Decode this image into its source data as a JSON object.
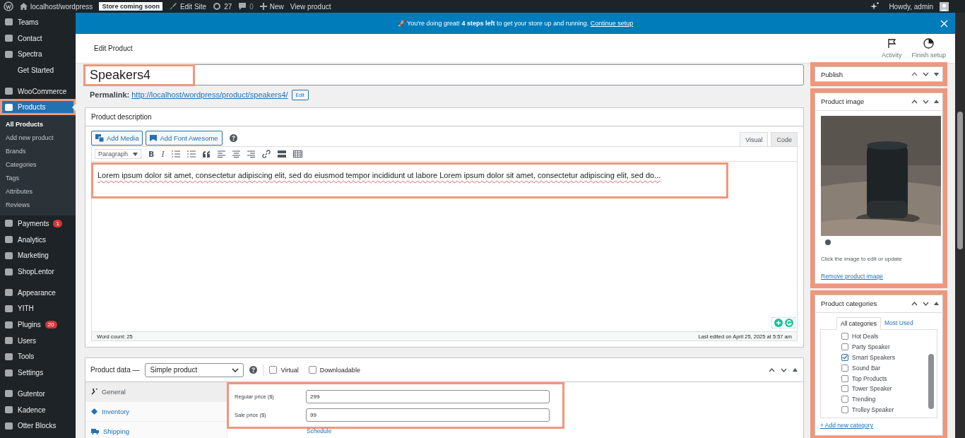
{
  "admin_bar": {
    "site": "localhost/wordpress",
    "badge": "Store coming soon",
    "items": [
      {
        "kind": "edit",
        "label": "Edit Site"
      },
      {
        "kind": "updates",
        "label": "27"
      },
      {
        "kind": "comments",
        "label": "0"
      },
      {
        "kind": "new",
        "label": "New"
      },
      {
        "kind": "link",
        "label": "View product"
      }
    ],
    "greeting": "Howdy, admin"
  },
  "sidebar": {
    "groups": [
      {
        "items": [
          {
            "kind": "icon",
            "label": "Teams",
            "selected": false,
            "highlighted": false
          },
          {
            "kind": "icon",
            "label": "Contact",
            "selected": false,
            "highlighted": false
          },
          {
            "kind": "icon",
            "label": "Spectra",
            "selected": false,
            "highlighted": false
          },
          {
            "kind": "plain",
            "label": "Get Started",
            "selected": false,
            "highlighted": false
          }
        ]
      },
      {
        "items": [
          {
            "kind": "icon",
            "label": "WooCommerce",
            "selected": false,
            "highlighted": false
          },
          {
            "kind": "icon",
            "label": "Products",
            "selected": true,
            "highlighted": true,
            "children": [
              {
                "label": "All Products",
                "selected": true
              },
              {
                "label": "Add new product",
                "selected": false
              },
              {
                "label": "Brands",
                "selected": false
              },
              {
                "label": "Categories",
                "selected": false
              },
              {
                "label": "Tags",
                "selected": false
              },
              {
                "label": "Attributes",
                "selected": false
              },
              {
                "label": "Reviews",
                "selected": false
              }
            ]
          },
          {
            "kind": "icon",
            "label": "Payments",
            "badge": "1",
            "selected": false,
            "highlighted": false
          },
          {
            "kind": "icon",
            "label": "Analytics",
            "selected": false,
            "highlighted": false
          },
          {
            "kind": "icon",
            "label": "Marketing",
            "selected": false,
            "highlighted": false
          },
          {
            "kind": "icon",
            "label": "ShopLentor",
            "selected": false,
            "highlighted": false
          }
        ]
      },
      {
        "items": [
          {
            "kind": "icon",
            "label": "Appearance",
            "selected": false,
            "highlighted": false
          },
          {
            "kind": "icon",
            "label": "YITH",
            "selected": false,
            "highlighted": false
          },
          {
            "kind": "icon",
            "label": "Plugins",
            "badge": "20",
            "selected": false,
            "highlighted": false
          },
          {
            "kind": "icon",
            "label": "Users",
            "selected": false,
            "highlighted": false
          },
          {
            "kind": "icon",
            "label": "Tools",
            "selected": false,
            "highlighted": false
          },
          {
            "kind": "icon",
            "label": "Settings",
            "selected": false,
            "highlighted": false
          }
        ]
      },
      {
        "items": [
          {
            "kind": "icon",
            "label": "Gutentor",
            "selected": false,
            "highlighted": false
          },
          {
            "kind": "icon",
            "label": "Kadence",
            "selected": false,
            "highlighted": false
          },
          {
            "kind": "icon",
            "label": "Otter Blocks",
            "selected": false,
            "highlighted": false
          }
        ]
      }
    ]
  },
  "notice": {
    "text": "🚀 You're doing great! **4 steps left** to get your store up and running.",
    "link": "Continue setup"
  },
  "header": {
    "title": "Edit Product",
    "actions": [
      {
        "kind": "flag",
        "label": "Activity"
      },
      {
        "kind": "clock",
        "label": "Finish setup"
      }
    ]
  },
  "title_field": {
    "value": "Speakers4",
    "highlighted": true
  },
  "permalink": {
    "label": "Permalink:",
    "url": "http://localhost/wordpress/product/speakers4/",
    "button": "Edit"
  },
  "description": {
    "title": "Product description",
    "buttons": [
      "Add Media",
      "Add Font Awesome"
    ],
    "tabs": [
      {
        "label": "Visual",
        "selected": true
      },
      {
        "label": "Code",
        "selected": false
      }
    ],
    "format": "Paragraph",
    "toolbar": [
      "B",
      "I"
    ],
    "content": "Lorem ipsum dolor sit amet, consectetur adipiscing elit, sed do eiusmod tempor incididunt ut labore Lorem ipsum dolor sit amet, consectetur adipiscing elit, sed do...",
    "highlighted": true,
    "word_count": "Word count: 25",
    "last_edited": "Last edited on April 25, 2025 at 5:57 am"
  },
  "product_data": {
    "label": "Product data —",
    "type": "Simple product",
    "options": [
      {
        "label": "Virtual",
        "checked": false
      },
      {
        "label": "Downloadable",
        "checked": false
      }
    ],
    "tabs": [
      {
        "label": "General",
        "selected": true
      },
      {
        "label": "Inventory",
        "selected": false
      },
      {
        "label": "Shipping",
        "selected": false
      }
    ],
    "fields": [
      {
        "label": "Regular price ($)",
        "value": "299"
      },
      {
        "label": "Sale price ($)",
        "value": "99"
      }
    ],
    "schedule": "Schedule",
    "highlighted": true
  },
  "publish": {
    "title": "Publish",
    "highlighted": true
  },
  "product_image": {
    "title": "Product image",
    "hint": "Click the image to edit or update",
    "remove": "Remove product image",
    "highlighted": true
  },
  "categories": {
    "title": "Product categories",
    "highlighted": true,
    "tabs": [
      {
        "label": "All categories",
        "selected": true
      },
      {
        "label": "Most Used",
        "selected": false
      }
    ],
    "items": [
      {
        "label": "Hot Deals",
        "checked": false
      },
      {
        "label": "Party Speaker",
        "checked": false
      },
      {
        "label": "Smart Speakers",
        "checked": true
      },
      {
        "label": "Sound Bar",
        "checked": false
      },
      {
        "label": "Top Products",
        "checked": false
      },
      {
        "label": "Tower Speaker",
        "checked": false
      },
      {
        "label": "Trending",
        "checked": false
      },
      {
        "label": "Trolley Speaker",
        "checked": false
      }
    ],
    "add": "+ Add new category"
  }
}
